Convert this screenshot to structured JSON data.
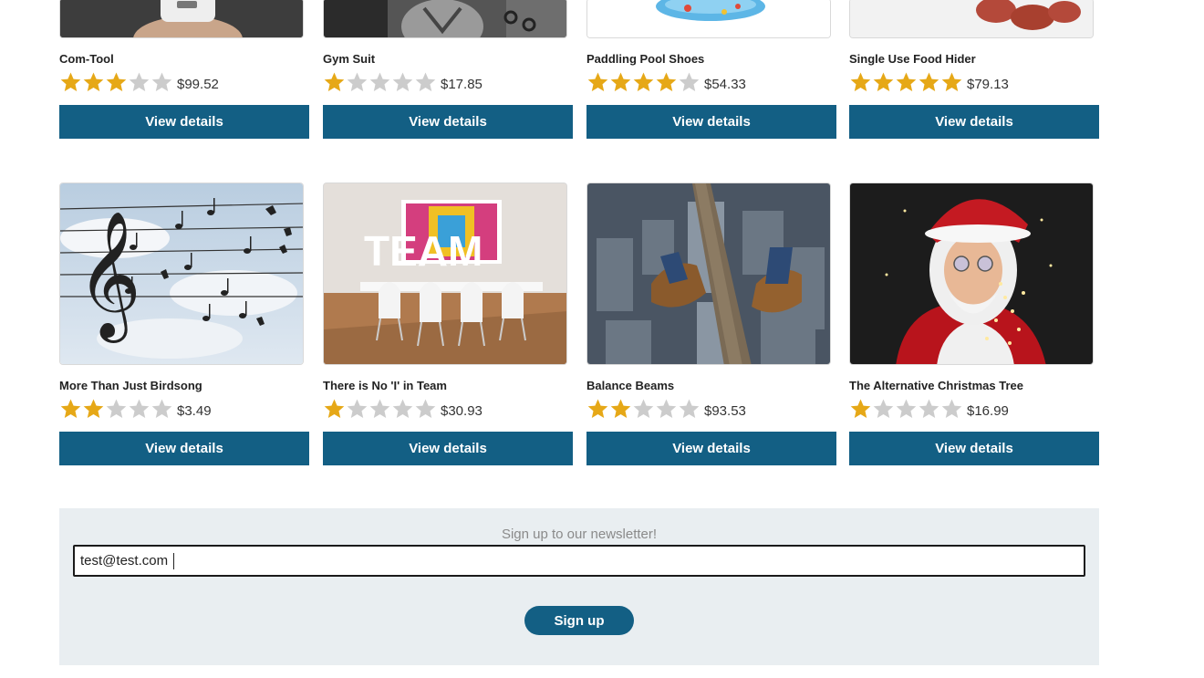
{
  "colors": {
    "button": "#135f84",
    "star_filled": "#e6a817",
    "star_empty": "#cccccc",
    "newsletter_bg": "#e9eef1"
  },
  "products": [
    {
      "name": "Com-Tool",
      "rating": 3,
      "price": "$99.52",
      "button_label": "View details",
      "image": "phone-in-hand-image"
    },
    {
      "name": "Gym Suit",
      "rating": 1,
      "price": "$17.85",
      "button_label": "View details",
      "image": "gym-athlete-image"
    },
    {
      "name": "Paddling Pool Shoes",
      "rating": 4,
      "price": "$54.33",
      "button_label": "View details",
      "image": "paddling-pool-image"
    },
    {
      "name": "Single Use Food Hider",
      "rating": 5,
      "price": "$79.13",
      "button_label": "View details",
      "image": "food-slices-image"
    },
    {
      "name": "More Than Just Birdsong",
      "rating": 2,
      "price": "$3.49",
      "button_label": "View details",
      "image": "birds-on-wires-image"
    },
    {
      "name": "There is No 'I' in Team",
      "rating": 1,
      "price": "$30.93",
      "button_label": "View details",
      "image": "team-office-image"
    },
    {
      "name": "Balance Beams",
      "rating": 2,
      "price": "$93.53",
      "button_label": "View details",
      "image": "feet-over-city-image"
    },
    {
      "name": "The Alternative Christmas Tree",
      "rating": 1,
      "price": "$16.99",
      "button_label": "View details",
      "image": "santa-with-lights-image"
    }
  ],
  "newsletter": {
    "title": "Sign up to our newsletter!",
    "email_value": "test@test.com",
    "button_label": "Sign up"
  }
}
